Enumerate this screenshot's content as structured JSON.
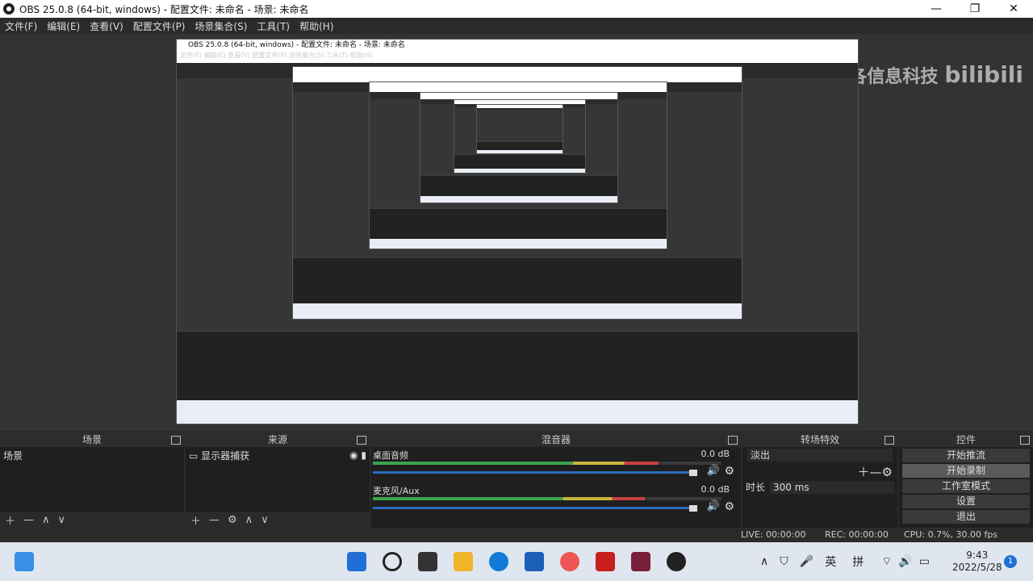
{
  "window": {
    "title": "OBS 25.0.8 (64-bit, windows) - 配置文件: 未命名 - 场景: 未命名"
  },
  "winctl": {
    "minimize": "—",
    "maximize": "❐",
    "close": "✕"
  },
  "menu": [
    "文件(F)",
    "编辑(E)",
    "查看(V)",
    "配置文件(P)",
    "场景集合(S)",
    "工具(T)",
    "帮助(H)"
  ],
  "watermark": {
    "text": "图宁宫各信息科技",
    "brand": "bilibili"
  },
  "nested": {
    "title": "OBS 25.0.8 (64-bit, windows) - 配置文件: 未命名 - 场景: 未命名",
    "menu": "文件(F)  编辑(E)  查看(V)  配置文件(P)  场景集合(S)  工具(T)  帮助(H)"
  },
  "docks": {
    "scenes": {
      "title": "场景",
      "items": [
        "场景"
      ]
    },
    "sources": {
      "title": "来源",
      "items": [
        "显示器捕获"
      ]
    },
    "mixer": {
      "title": "混音器",
      "channels": [
        {
          "name": "桌面音频",
          "db": "0.0 dB",
          "level": 0.82
        },
        {
          "name": "麦克风/Aux",
          "db": "0.0 dB",
          "level": 0.78
        }
      ]
    },
    "transitions": {
      "title": "转场特效",
      "selected": "淡出",
      "duration_label": "时长",
      "duration": "300 ms"
    },
    "controls": {
      "title": "控件",
      "buttons": [
        "开始推流",
        "开始录制",
        "工作室模式",
        "设置",
        "退出"
      ]
    }
  },
  "status": {
    "live": "LIVE: 00:00:00",
    "rec": "REC: 00:00:00",
    "cpu": "CPU: 0.7%, 30.00 fps"
  },
  "taskbar": {
    "ime_en": "英",
    "ime_pin": "拼",
    "time": "9:43",
    "date": "2022/5/28",
    "badge": "1"
  },
  "colors": {
    "accent": "#2f6bbf",
    "meter_green": "#3fa34d",
    "meter_yellow": "#c9b53b",
    "meter_red": "#c94040"
  }
}
